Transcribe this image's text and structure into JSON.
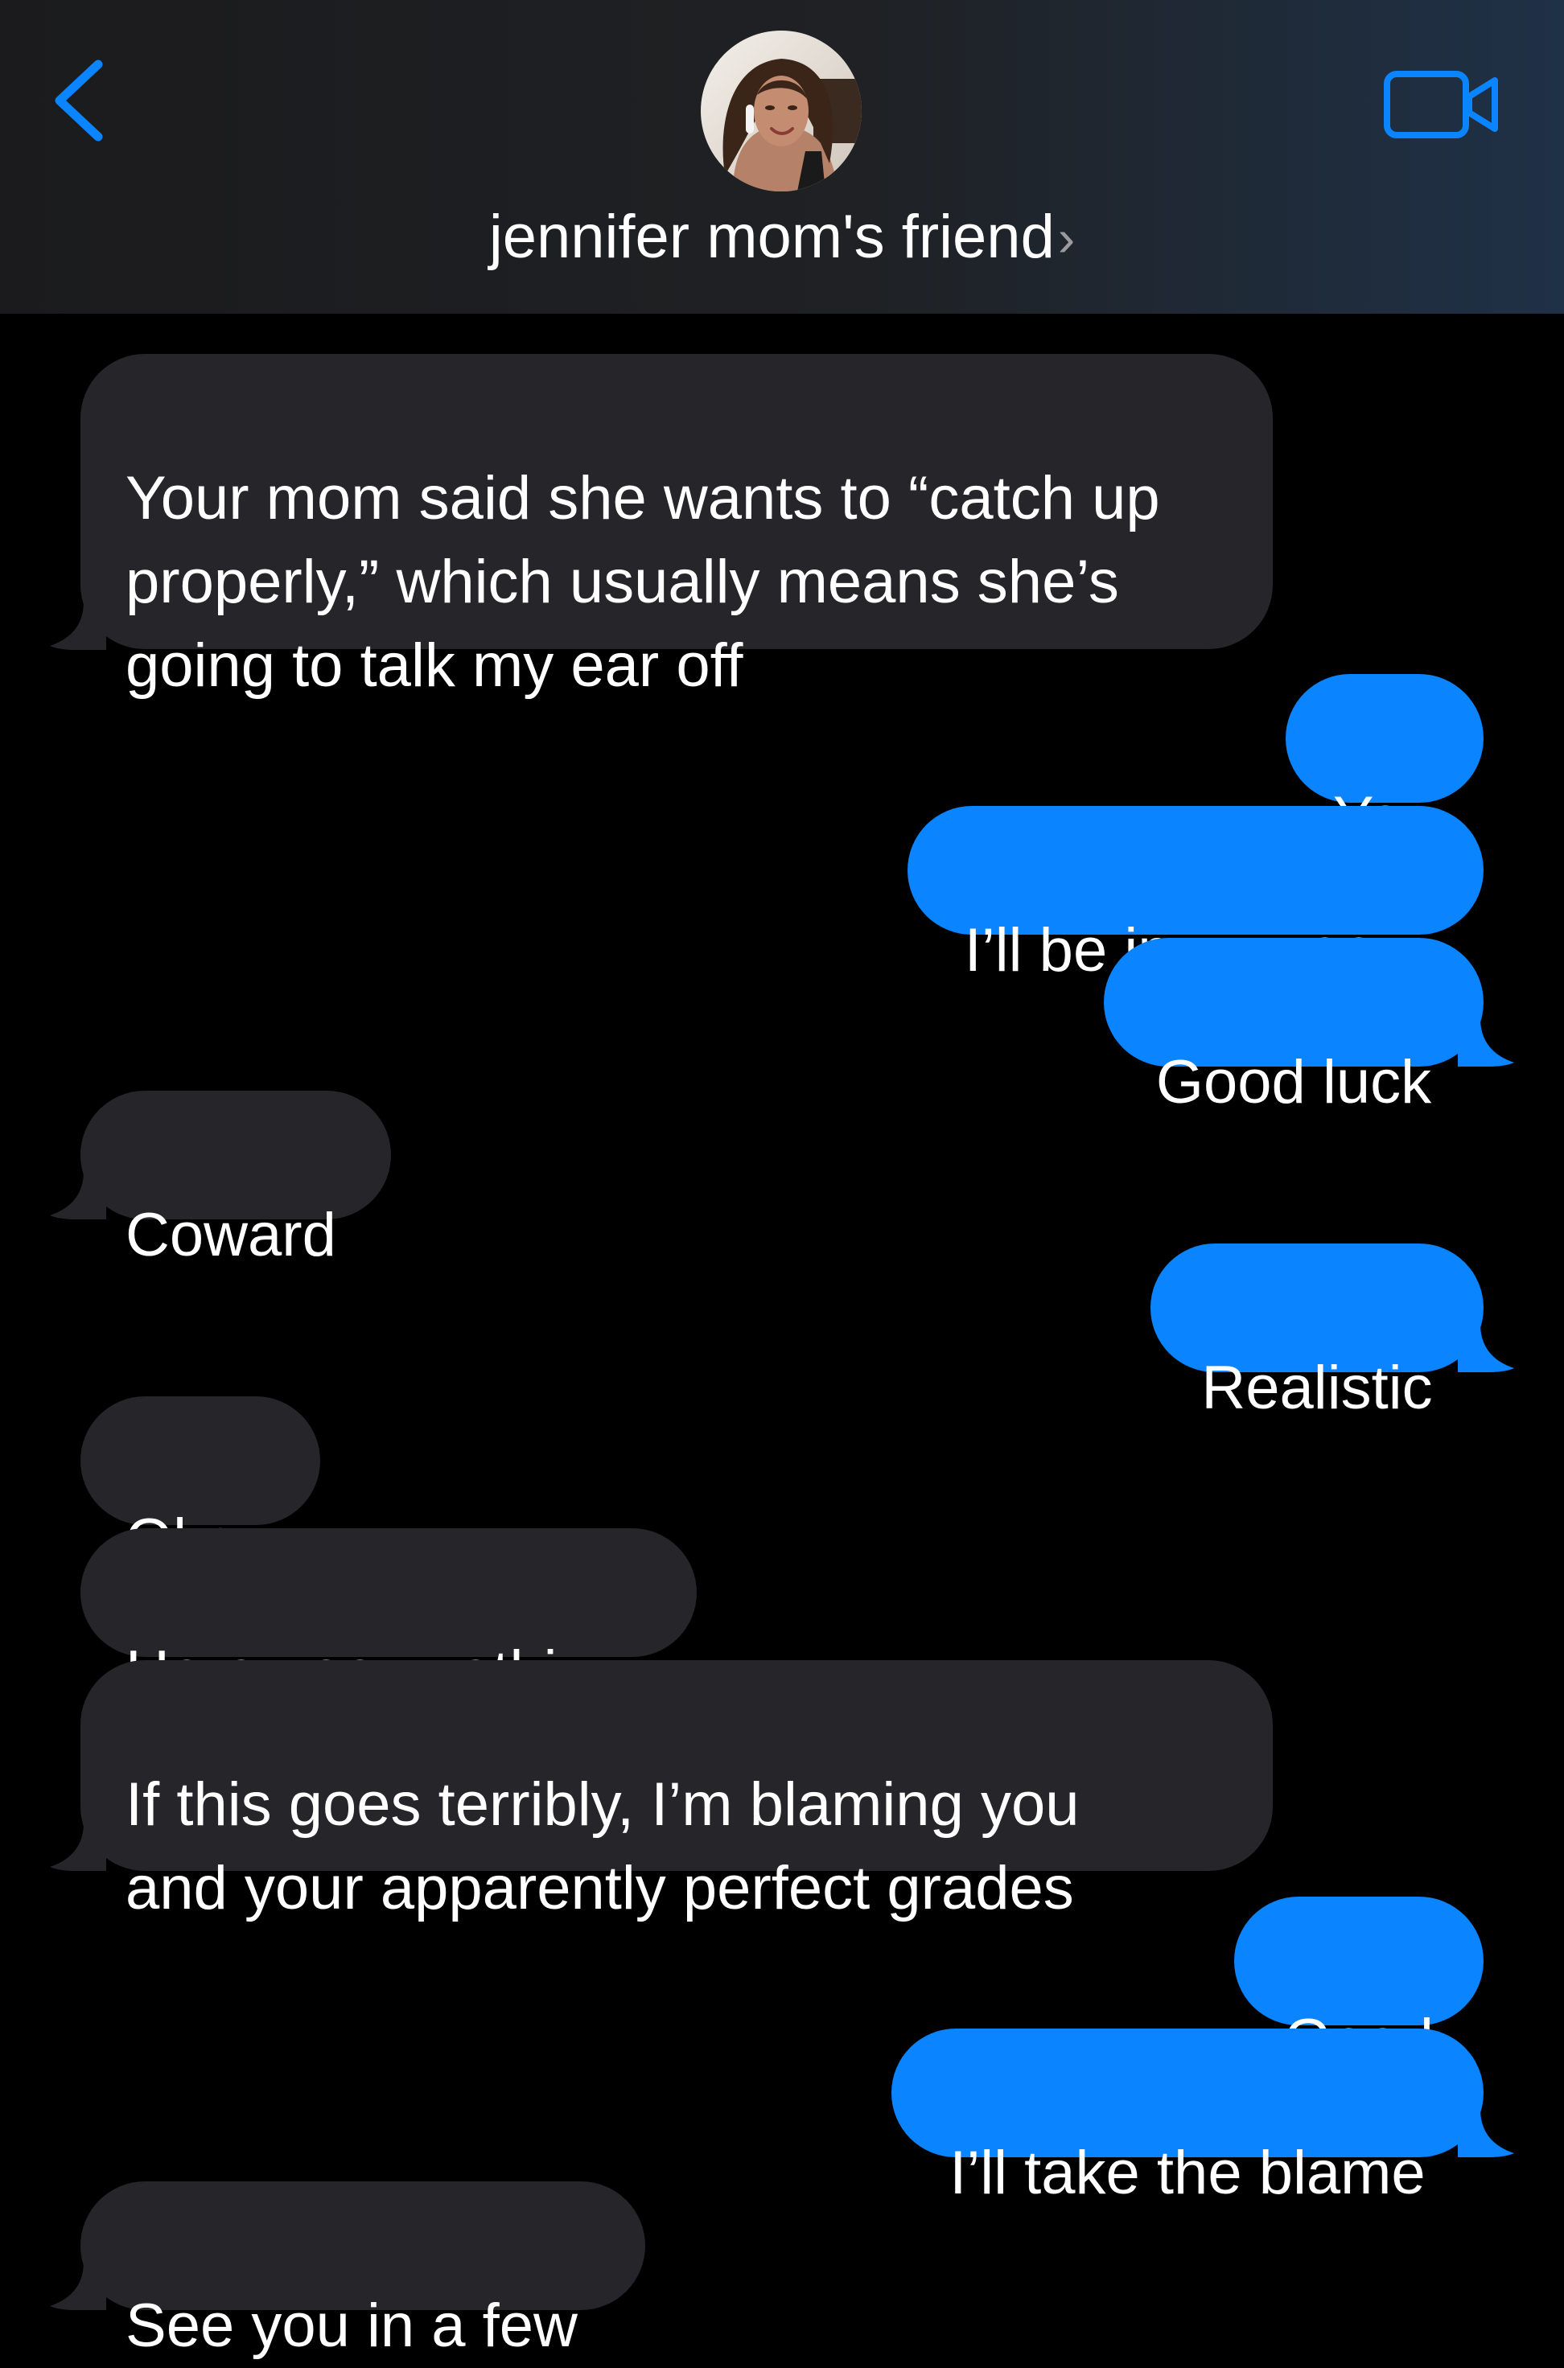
{
  "header": {
    "contact_name": "jennifer mom's friend",
    "chevron": "›",
    "back_icon": "chevron-left-icon",
    "video_icon": "video-camera-icon",
    "accent_color": "#0a84ff"
  },
  "messages": [
    {
      "sender": "them",
      "text": "Your mom said she wants to “catch up\nproperly,” which usually means she’s\ngoing to talk my ear off"
    },
    {
      "sender": "me",
      "text": "Yep"
    },
    {
      "sender": "me",
      "text": "I’ll be in my room"
    },
    {
      "sender": "me",
      "text": "Good luck"
    },
    {
      "sender": "them",
      "text": "Coward"
    },
    {
      "sender": "me",
      "text": "Realistic"
    },
    {
      "sender": "them",
      "text": "Okay"
    },
    {
      "sender": "them",
      "text": "Here goes nothing"
    },
    {
      "sender": "them",
      "text": "If this goes terribly, I’m blaming you\nand your apparently perfect grades"
    },
    {
      "sender": "me",
      "text": "Good"
    },
    {
      "sender": "me",
      "text": "I’ll take the blame"
    },
    {
      "sender": "them",
      "text": "See you in a few"
    }
  ],
  "colors": {
    "incoming_bubble": "#26252a",
    "outgoing_bubble": "#0a84ff",
    "background": "#000000"
  }
}
